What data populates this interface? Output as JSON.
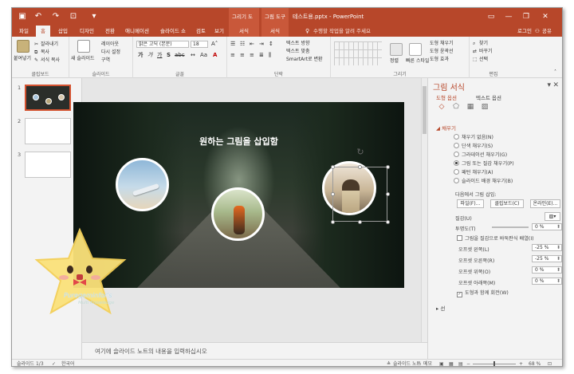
{
  "titlebar": {
    "ctx_tab_drawing": "그리기 도구",
    "ctx_tab_picture": "그림 도구",
    "doc_title": "테스트용.pptx - PowerPoint"
  },
  "tabs": {
    "file": "파일",
    "home": "홈",
    "insert": "삽입",
    "design": "디자인",
    "transitions": "전환",
    "animations": "애니메이션",
    "slideshow": "슬라이드 쇼",
    "review": "검토",
    "view": "보기",
    "format_drawing": "서식",
    "format_picture": "서식",
    "tell_me": "수행할 작업을 알려 주세요",
    "login": "로그인",
    "share": "공유"
  },
  "ribbon": {
    "paste": "붙여넣기",
    "cut": "잘라내기",
    "copy": "복사",
    "format_painter": "서식 복사",
    "clipboard_group": "클립보드",
    "new_slide": "새 슬라이드",
    "layout": "레이아웃",
    "reset": "다시 설정",
    "section": "구역",
    "slides_group": "슬라이드",
    "font_name": "맑은 고딕 (본문)",
    "font_size": "18",
    "font_group": "글꼴",
    "paragraph_group": "단락",
    "text_direction": "텍스트 방향",
    "align_text": "텍스트 맞춤",
    "smartart": "SmartArt로 변환",
    "drawing_group": "그리기",
    "arrange": "정렬",
    "quick_styles": "빠른 스타일",
    "shape_fill": "도형 채우기",
    "shape_outline": "도형 윤곽선",
    "shape_effects": "도형 효과",
    "find": "찾기",
    "replace": "바꾸기",
    "select": "선택",
    "editing_group": "편집"
  },
  "thumbnails": [
    {
      "num": "1"
    },
    {
      "num": "2"
    },
    {
      "num": "3"
    }
  ],
  "slide": {
    "title": "원하는 그림을 삽입함"
  },
  "notes": {
    "placeholder": "여기에 슬라이드 노트의 내용을 입력하십시오"
  },
  "pane": {
    "title": "그림 서식",
    "tab_shape": "도형 옵션",
    "tab_text": "텍스트 옵션",
    "fill_section": "채우기",
    "fill_options": [
      {
        "label": "채우기 없음(N)",
        "selected": false
      },
      {
        "label": "단색 채우기(S)",
        "selected": false
      },
      {
        "label": "그라데이션 채우기(G)",
        "selected": false
      },
      {
        "label": "그림 또는 질감 채우기(P)",
        "selected": true
      },
      {
        "label": "패턴 채우기(A)",
        "selected": false
      },
      {
        "label": "슬라이드 배경 채우기(B)",
        "selected": false
      }
    ],
    "insert_from": "다음에서 그림 삽입:",
    "btn_file": "파일(F)...",
    "btn_clipboard": "클립보드(C)",
    "btn_online": "온라인(E)...",
    "texture": "질감(U)",
    "transparency": "투명도(T)",
    "transparency_val": "0 %",
    "tile_checkbox": "그림을 질감으로 바둑판식 배열(I)",
    "offset_left": "오프셋 왼쪽(L)",
    "offset_left_val": "-25 %",
    "offset_right": "오프셋 오른쪽(R)",
    "offset_right_val": "-25 %",
    "offset_top": "오프셋 위쪽(O)",
    "offset_top_val": "0 %",
    "offset_bottom": "오프셋 아래쪽(M)",
    "offset_bottom_val": "0 %",
    "rotate_with_shape": "도형과 함께 회전(W)",
    "line_section": "선"
  },
  "status": {
    "slide_count": "슬라이드 1/3",
    "language": "한국어",
    "notes_btn": "슬라이드 노트",
    "comments_btn": "메모",
    "zoom": "68 %"
  },
  "watermark": {
    "line1": "Puregeminfor's",
    "line2": "Multi Knowledge"
  },
  "colors": {
    "accent": "#b7472a",
    "selection": "#d35230"
  }
}
